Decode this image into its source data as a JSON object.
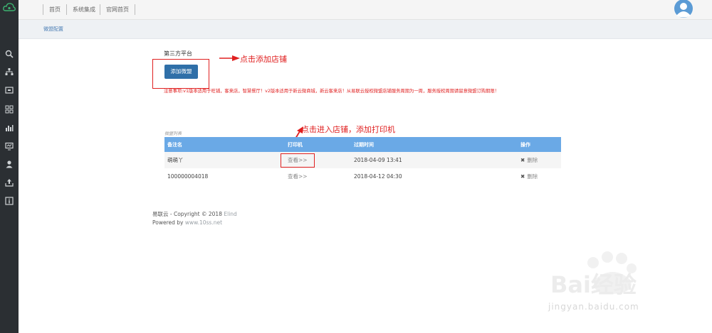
{
  "sidebar": {
    "logo_icon": "cloud-logo-icon",
    "icons": [
      "search-icon",
      "sitemap-icon",
      "screen-icon",
      "grid-icon",
      "bar-chart-icon",
      "monitor-icon",
      "user-icon",
      "upload-icon",
      "info-icon"
    ]
  },
  "topnav": {
    "items": [
      "首页",
      "系统集成",
      "官网首页"
    ]
  },
  "breadcrumb": "微盟配置",
  "main": {
    "platform_title": "第三方平台",
    "add_button": "添加微盟",
    "annotation_add": "点击添加店铺",
    "notice": "注意事项:v1版本适用于旺铺，客来店，智慧餐厅！v2版本适用于新云微商城，新云客来店！从易联云授权微盟店铺服务周期为一周，服务授权周期请留意微盟订购期限！",
    "list_caption": "微盟列表",
    "annotation_view": "点击进入店铺，添加打印机",
    "table": {
      "headers": [
        "备注名",
        "打印机",
        "过期时间",
        "操作"
      ],
      "rows": [
        {
          "name": "萌萌丫",
          "printer": "查看>>",
          "expire": "2018-04-09 13:41",
          "action": "删除"
        },
        {
          "name": "100000004018",
          "printer": "查看>>",
          "expire": "2018-04-12 04:30",
          "action": "删除"
        }
      ]
    }
  },
  "footer": {
    "line1_brand": "易联云",
    "line1_copy": " - Copyright © 2018 ",
    "line1_link": "Elind",
    "line2_prefix": "Powered by ",
    "line2_link": "www.10ss.net"
  },
  "watermark": {
    "logo_text": "Bai经验",
    "url": "jingyan.baidu.com"
  },
  "colors": {
    "sidebar_bg": "#2b2f33",
    "primary_button": "#2f6fa8",
    "table_header": "#6aa9e6",
    "annotation_red": "#e02020"
  }
}
